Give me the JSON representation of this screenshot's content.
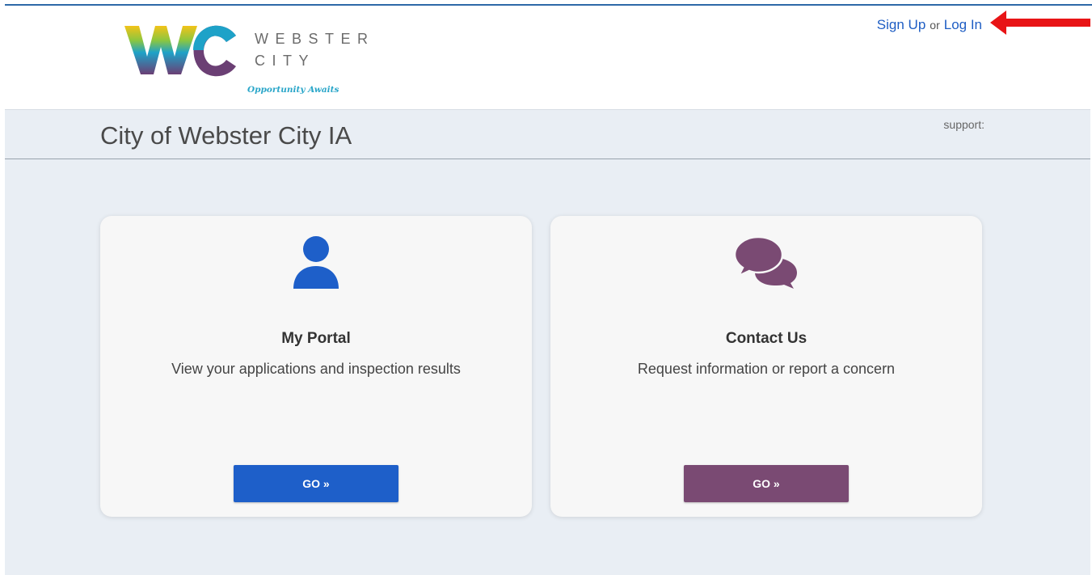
{
  "header": {
    "logo": {
      "word_line1": "WEBSTER",
      "word_line2": "CITY",
      "tagline": "Opportunity Awaits"
    },
    "auth": {
      "sign_up": "Sign Up",
      "or": "or",
      "log_in": "Log In"
    }
  },
  "title_bar": {
    "page_title": "City of Webster City IA",
    "support_label": "support:"
  },
  "cards": [
    {
      "icon": "user-icon",
      "title": "My Portal",
      "description": "View your applications and inspection results",
      "button_label": "GO »",
      "color": "#1e5fc9"
    },
    {
      "icon": "chat-bubbles-icon",
      "title": "Contact Us",
      "description": "Request information or report a concern",
      "button_label": "GO »",
      "color": "#7a4a73"
    }
  ],
  "annotation": {
    "arrow_color": "#e81416"
  }
}
